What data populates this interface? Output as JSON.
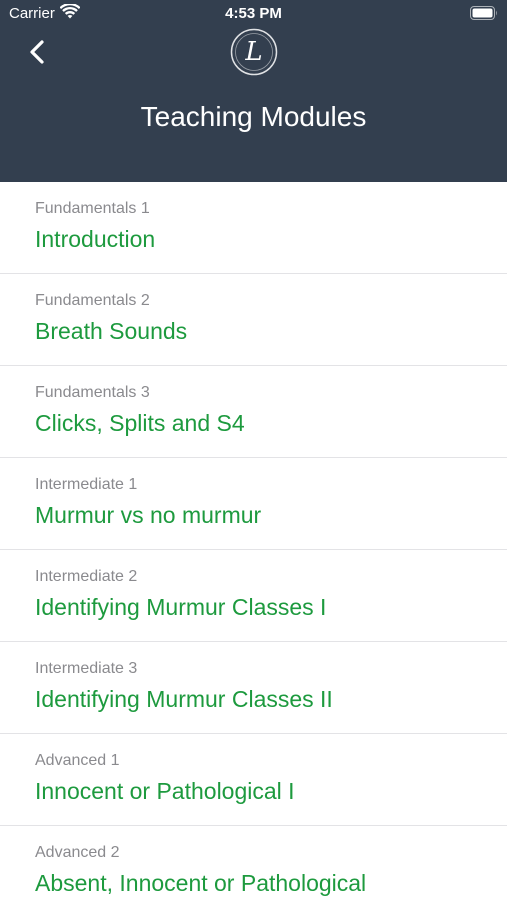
{
  "status_bar": {
    "carrier": "Carrier",
    "time": "4:53 PM"
  },
  "header": {
    "title": "Teaching Modules",
    "back_icon": "chevron-left-icon",
    "logo_letter": "L"
  },
  "colors": {
    "header_bg": "#333f4f",
    "module_title": "#1d9a3e",
    "module_level": "#8a8a8e"
  },
  "modules": [
    {
      "level": "Fundamentals 1",
      "title": "Introduction"
    },
    {
      "level": "Fundamentals 2",
      "title": "Breath Sounds"
    },
    {
      "level": "Fundamentals 3",
      "title": "Clicks, Splits and S4"
    },
    {
      "level": "Intermediate 1",
      "title": "Murmur vs no murmur"
    },
    {
      "level": "Intermediate 2",
      "title": "Identifying Murmur Classes I"
    },
    {
      "level": "Intermediate 3",
      "title": "Identifying Murmur Classes II"
    },
    {
      "level": "Advanced 1",
      "title": "Innocent or Pathological I"
    },
    {
      "level": "Advanced 2",
      "title": "Absent, Innocent or Pathological"
    }
  ]
}
